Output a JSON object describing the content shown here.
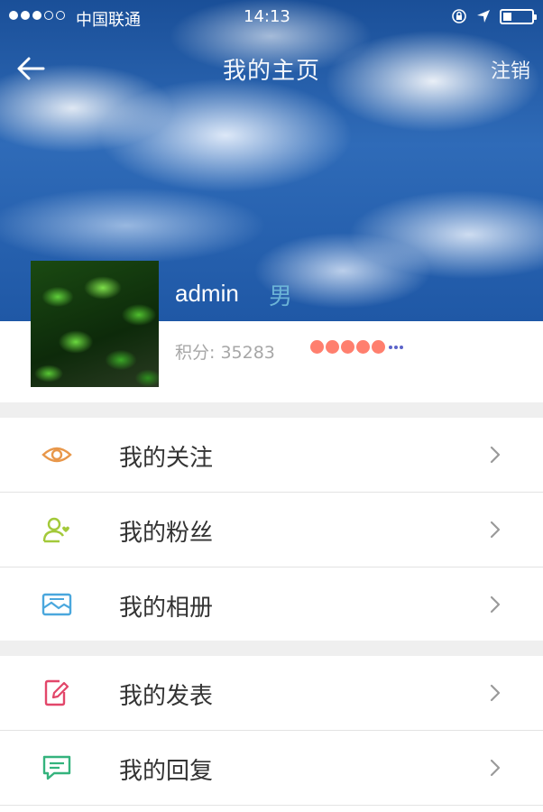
{
  "status_bar": {
    "carrier": "中国联通",
    "time": "14:13"
  },
  "header": {
    "title": "我的主页",
    "logout_label": "注销"
  },
  "profile": {
    "username": "admin",
    "gender": "男",
    "points_label": "积分:",
    "points_value": "35283"
  },
  "menu": {
    "group1": [
      {
        "label": "我的关注",
        "icon": "eye-icon",
        "color": "#e8974a"
      },
      {
        "label": "我的粉丝",
        "icon": "fans-icon",
        "color": "#a3c93a"
      },
      {
        "label": "我的相册",
        "icon": "album-icon",
        "color": "#4aa7dd"
      }
    ],
    "group2": [
      {
        "label": "我的发表",
        "icon": "post-icon",
        "color": "#e2476a"
      },
      {
        "label": "我的回复",
        "icon": "reply-icon",
        "color": "#34b37d"
      }
    ]
  }
}
